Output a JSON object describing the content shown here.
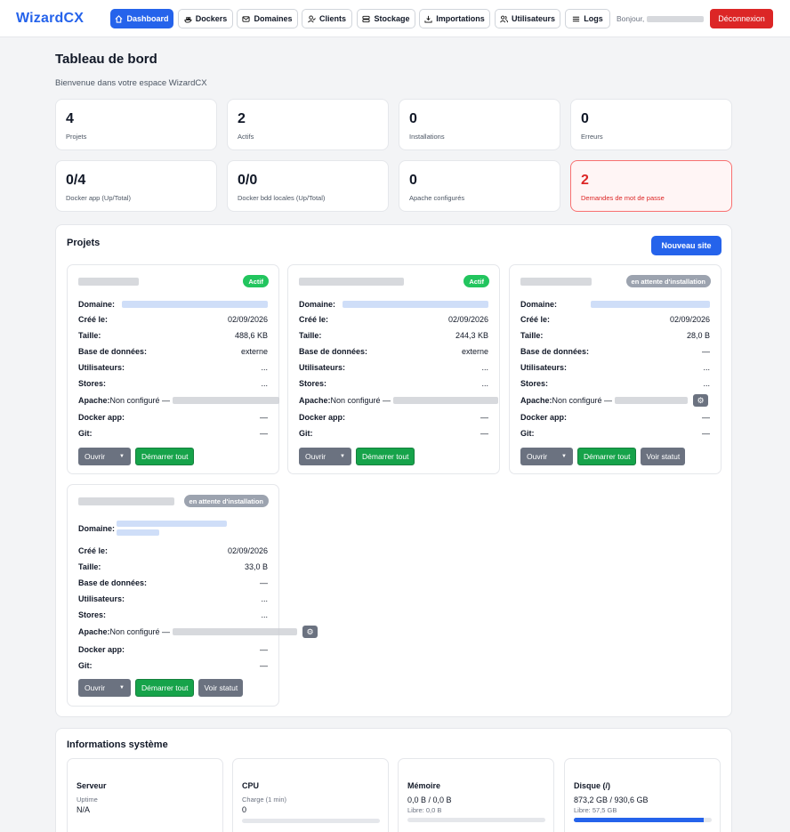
{
  "nav": {
    "brand": "WizardCX",
    "items": [
      {
        "label": "Dashboard",
        "icon": "home-icon"
      },
      {
        "label": "Dockers",
        "icon": "docker-icon"
      },
      {
        "label": "Domaines",
        "icon": "mail-icon"
      },
      {
        "label": "Clients",
        "icon": "user-check-icon"
      },
      {
        "label": "Stockage",
        "icon": "storage-icon"
      },
      {
        "label": "Importations",
        "icon": "download-icon"
      },
      {
        "label": "Utilisateurs",
        "icon": "users-icon"
      },
      {
        "label": "Logs",
        "icon": "list-icon"
      }
    ],
    "greeting": "Bonjour,",
    "logout_label": "Déconnexion"
  },
  "header": {
    "title": "Tableau de bord",
    "subtitle": "Bienvenue dans votre espace WizardCX"
  },
  "stats": [
    {
      "value": "4",
      "label": "Projets"
    },
    {
      "value": "2",
      "label": "Actifs"
    },
    {
      "value": "0",
      "label": "Installations"
    },
    {
      "value": "0",
      "label": "Erreurs"
    },
    {
      "value": "0/4",
      "label": "Docker app (Up/Total)"
    },
    {
      "value": "0/0",
      "label": "Docker bdd locales (Up/Total)"
    },
    {
      "value": "0",
      "label": "Apache configurés"
    },
    {
      "value": "2",
      "label": "Demandes de mot de passe"
    }
  ],
  "projects": {
    "title": "Projets",
    "new_site_label": "Nouveau site",
    "field_labels": {
      "domain": "Domaine:",
      "created": "Créé le:",
      "size": "Taille:",
      "database": "Base de données:",
      "users": "Utilisateurs:",
      "stores": "Stores:",
      "apache": "Apache:",
      "docker": "Docker app:",
      "git": "Git:"
    },
    "apache_text": "Non configuré —",
    "open_label": "Ouvrir",
    "start_label": "Démarrer tout",
    "status_label": "Voir statut",
    "cards": [
      {
        "badge": "Actif",
        "created": "02/09/2026",
        "size": "488,6 KB",
        "database": "externe",
        "users": "...",
        "stores": "...",
        "docker": "—",
        "git": "—"
      },
      {
        "badge": "Actif",
        "created": "02/09/2026",
        "size": "244,3 KB",
        "database": "externe",
        "users": "...",
        "stores": "...",
        "docker": "—",
        "git": "—"
      },
      {
        "badge": "en attente d'installation",
        "created": "02/09/2026",
        "size": "28,0 B",
        "database": "—",
        "users": "...",
        "stores": "...",
        "docker": "—",
        "git": "—"
      },
      {
        "badge": "en attente d'installation",
        "created": "02/09/2026",
        "size": "33,0 B",
        "database": "—",
        "users": "...",
        "stores": "...",
        "docker": "—",
        "git": "—"
      }
    ]
  },
  "system": {
    "title": "Informations système",
    "cards": [
      {
        "title": "Serveur",
        "sub": "Uptime",
        "main": "N/A"
      },
      {
        "title": "CPU",
        "sub": "Charge (1 min)",
        "main": "0",
        "fill": 0
      },
      {
        "title": "Mémoire",
        "main": "0,0 B / 0,0 B",
        "sub": "Libre: 0,0 B",
        "fill": 0
      },
      {
        "title": "Disque (/)",
        "main": "873,2 GB / 930,6 GB",
        "sub": "Libre: 57,5 GB",
        "fill": 0.94
      }
    ]
  }
}
